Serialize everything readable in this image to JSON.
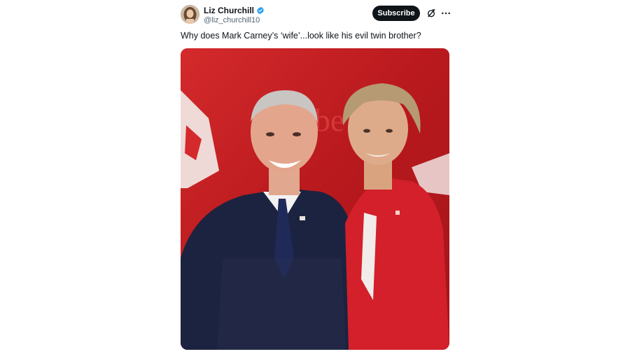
{
  "author": {
    "display_name": "Liz Churchill",
    "handle": "@liz_churchill10",
    "verified": true,
    "avatar_icon": "profile-photo"
  },
  "actions": {
    "subscribe_label": "Subscribe",
    "grok_icon": "grok-icon",
    "more_icon": "more-horizontal-icon"
  },
  "tweet": {
    "text": "Why does Mark Carney’s ‘wife’...look like his evil twin brother?"
  },
  "media": {
    "type": "photo",
    "background_lettering": "Libe"
  },
  "colors": {
    "subscribe_bg": "#0f1419",
    "verified_blue": "#1d9bf0",
    "backdrop_red": "#c81f24"
  }
}
